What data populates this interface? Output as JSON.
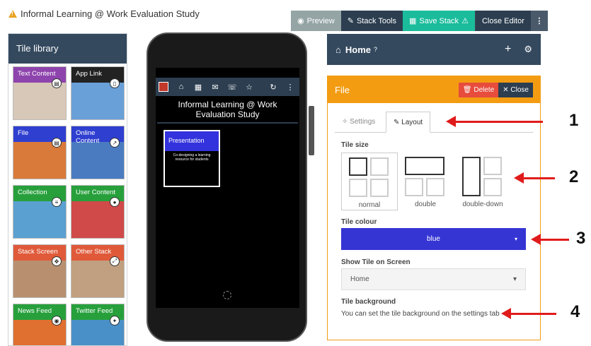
{
  "app_title": "Informal Learning @ Work Evaluation Study",
  "toolbar": {
    "preview": "Preview",
    "stack_tools": "Stack Tools",
    "save_stack": "Save Stack",
    "close_editor": "Close Editor"
  },
  "tile_library": {
    "heading": "Tile library",
    "tiles": [
      {
        "label": "Text Content",
        "color": "#8e44ad"
      },
      {
        "label": "App Link",
        "color": "#222222"
      },
      {
        "label": "File",
        "color": "#2f3fd0"
      },
      {
        "label": "Online Content",
        "color": "#2f3fd0"
      },
      {
        "label": "Collection",
        "color": "#27a03c"
      },
      {
        "label": "User Content",
        "color": "#27a03c"
      },
      {
        "label": "Stack Screen",
        "color": "#e05a3a"
      },
      {
        "label": "Other Stack",
        "color": "#e05a3a"
      },
      {
        "label": "News Feed",
        "color": "#27a03c"
      },
      {
        "label": "Twitter Feed",
        "color": "#27a03c"
      }
    ]
  },
  "phone": {
    "title": "Informal Learning @ Work Evaluation Study",
    "tile_title": "Presentation",
    "tile_text": "Co-designing a learning resource for students"
  },
  "home_bar": {
    "label": "Home"
  },
  "file_panel": {
    "title": "File",
    "delete": "Delete",
    "close": "Close",
    "tabs": {
      "settings": "Settings",
      "layout": "Layout"
    },
    "tile_size_label": "Tile size",
    "sizes": {
      "normal": "normal",
      "double": "double",
      "double_down": "double-down"
    },
    "tile_colour_label": "Tile colour",
    "tile_colour_value": "blue",
    "show_on_screen_label": "Show Tile on Screen",
    "show_on_screen_value": "Home",
    "tile_background_label": "Tile background",
    "tile_background_text": "You can set the tile background on the settings tab"
  },
  "annotations": [
    "1",
    "2",
    "3",
    "4"
  ]
}
